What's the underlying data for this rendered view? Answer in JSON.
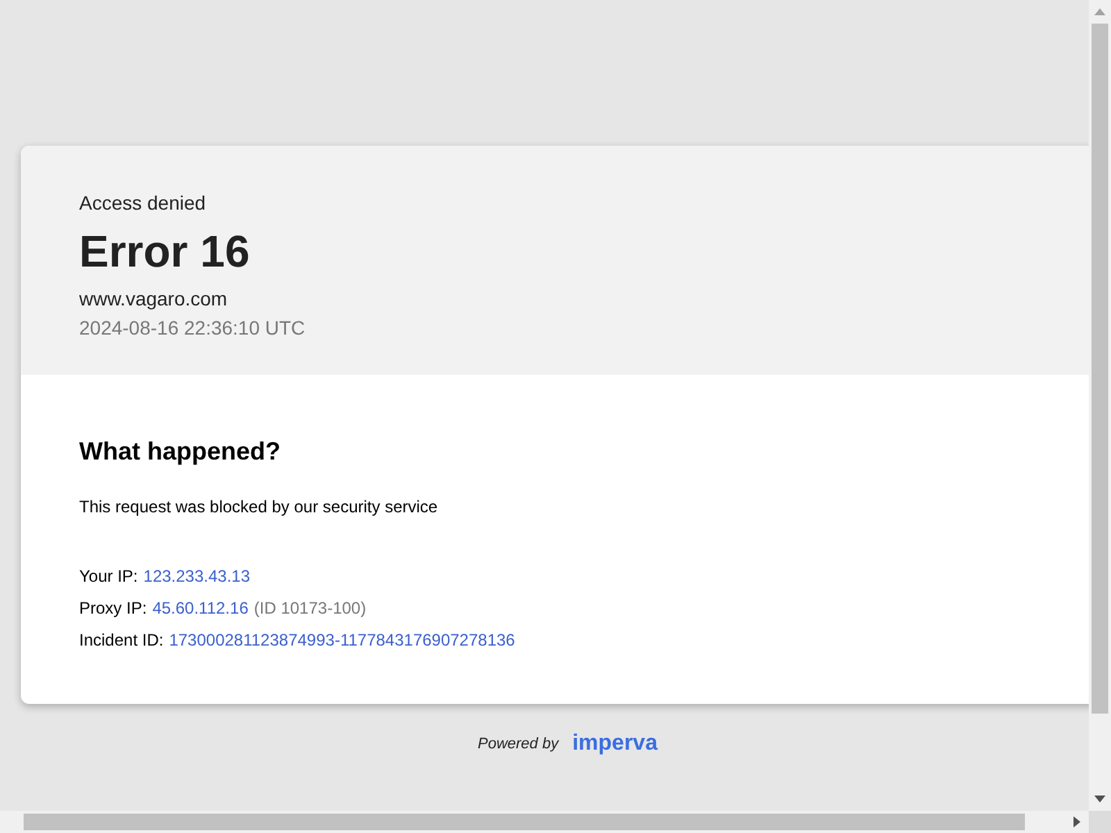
{
  "header": {
    "subtitle": "Access denied",
    "title": "Error 16",
    "domain": "www.vagaro.com",
    "timestamp": "2024-08-16 22:36:10 UTC"
  },
  "body": {
    "heading": "What happened?",
    "message": "This request was blocked by our security service",
    "details": [
      {
        "label": "Your IP:",
        "value": "123.233.43.13"
      },
      {
        "label": "Proxy IP:",
        "value": "45.60.112.16",
        "note": "(ID 10173-100)"
      },
      {
        "label": "Incident ID:",
        "value": "173000281123874993-1177843176907278136"
      }
    ]
  },
  "footer": {
    "powered_by": "Powered by",
    "brand": "imperva"
  }
}
